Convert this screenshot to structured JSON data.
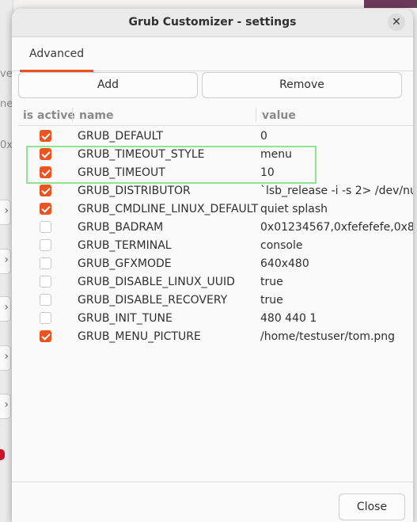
{
  "window": {
    "title": "Grub Customizer - settings"
  },
  "tabs": [
    {
      "label": "Advanced",
      "active": true
    }
  ],
  "toolbar": {
    "add_label": "Add",
    "remove_label": "Remove"
  },
  "table": {
    "headers": {
      "active": "is active",
      "name": "name",
      "value": "value"
    },
    "rows": [
      {
        "active": true,
        "name": "GRUB_DEFAULT",
        "value": "0"
      },
      {
        "active": true,
        "name": "GRUB_TIMEOUT_STYLE",
        "value": "menu"
      },
      {
        "active": true,
        "name": "GRUB_TIMEOUT",
        "value": "10"
      },
      {
        "active": true,
        "name": "GRUB_DISTRIBUTOR",
        "value": "`lsb_release -i -s 2> /dev/nu"
      },
      {
        "active": true,
        "name": "GRUB_CMDLINE_LINUX_DEFAULT",
        "value": "quiet splash"
      },
      {
        "active": false,
        "name": "GRUB_BADRAM",
        "value": "0x01234567,0xfefefefe,0x8"
      },
      {
        "active": false,
        "name": "GRUB_TERMINAL",
        "value": "console"
      },
      {
        "active": false,
        "name": "GRUB_GFXMODE",
        "value": "640x480"
      },
      {
        "active": false,
        "name": "GRUB_DISABLE_LINUX_UUID",
        "value": "true"
      },
      {
        "active": false,
        "name": "GRUB_DISABLE_RECOVERY",
        "value": "true"
      },
      {
        "active": false,
        "name": "GRUB_INIT_TUNE",
        "value": "480 440 1"
      },
      {
        "active": true,
        "name": "GRUB_MENU_PICTURE",
        "value": "/home/testuser/tom.png"
      }
    ]
  },
  "footer": {
    "close_label": "Close"
  },
  "background_fragments": [
    "ve",
    "ne",
    "0x"
  ],
  "colors": {
    "accent": "#e95420",
    "highlight": "#8fe58f"
  }
}
